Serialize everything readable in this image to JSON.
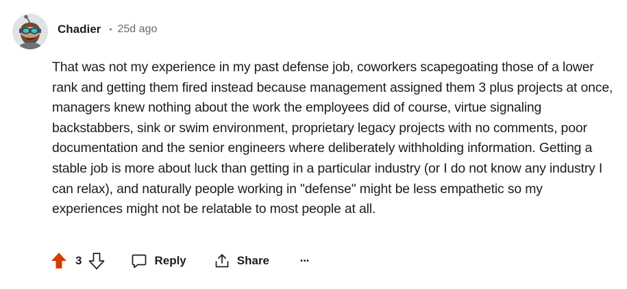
{
  "comment": {
    "author": "Chadier",
    "separator": "•",
    "timestamp": "25d ago",
    "body": "That was not my experience in my past defense job, coworkers scapegoating those of a lower rank and getting them fired instead because management assigned them 3 plus projects at once, managers knew nothing about the work the employees did of course, virtue signaling backstabbers, sink or swim environment, proprietary legacy projects with no comments, poor documentation and the senior engineers where deliberately withholding information. Getting a stable job is more about luck than getting in a particular industry (or I do not know any industry I can relax), and naturally people working in \"defense\" might be less empathetic so my experiences might not be relatable to most people at all.",
    "avatar_icon": "snoo-avatar-icon"
  },
  "actions": {
    "upvote_icon": "upvote-arrow-icon",
    "upvote_color": "#d93a00",
    "score": "3",
    "downvote_icon": "downvote-arrow-icon",
    "reply_label": "Reply",
    "reply_icon": "speech-bubble-icon",
    "share_label": "Share",
    "share_icon": "share-arrow-icon",
    "more_label": "•••"
  }
}
